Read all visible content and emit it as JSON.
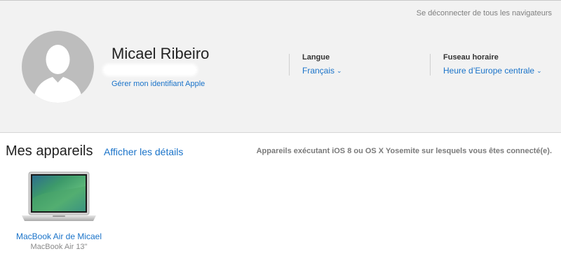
{
  "header": {
    "signout_all": "Se déconnecter de tous les navigateurs",
    "user_name": "Micael Ribeiro",
    "manage_id": "Gérer mon identifiant Apple",
    "language": {
      "label": "Langue",
      "value": "Français"
    },
    "timezone": {
      "label": "Fuseau horaire",
      "value": "Heure d’Europe centrale"
    }
  },
  "devices": {
    "title": "Mes appareils",
    "details_link": "Afficher les détails",
    "note": "Appareils exécutant iOS 8 ou OS X Yosemite sur lesquels vous êtes connecté(e).",
    "items": [
      {
        "name": "MacBook Air de Micael",
        "model": "MacBook Air 13\"",
        "icon": "macbook-air-icon"
      }
    ]
  },
  "colors": {
    "link": "#1a73c9",
    "header_bg": "#f2f2f2",
    "avatar": "#bdbdbd"
  }
}
